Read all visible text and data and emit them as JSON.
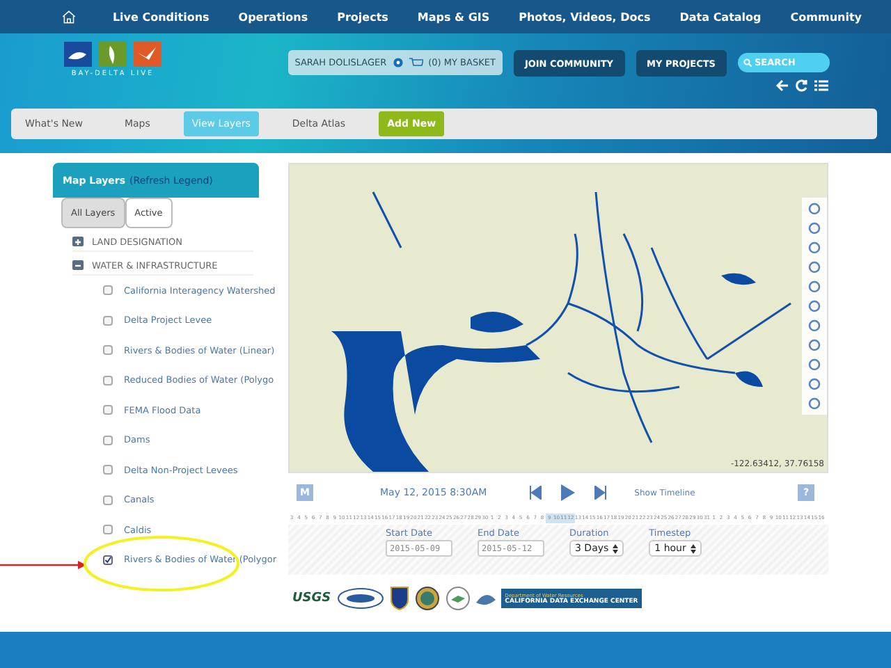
{
  "top_nav": {
    "items": [
      "Live Conditions",
      "Operations",
      "Projects",
      "Maps & GIS",
      "Photos, Videos, Docs",
      "Data Catalog",
      "Community"
    ]
  },
  "header": {
    "logo_text": "BAY-DELTA LIVE",
    "user": "SARAH DOLISLAGER",
    "basket": "(0) MY BASKET",
    "buttons": [
      "JOIN COMMUNITY",
      "MY PROJECTS"
    ],
    "search": {
      "placeholder": "SEARCH"
    }
  },
  "sub_nav": [
    {
      "label": "What's New",
      "kind": "link",
      "selected": false
    },
    {
      "label": "Maps",
      "kind": "link",
      "selected": false
    },
    {
      "label": "View Layers",
      "kind": "link",
      "selected": true
    },
    {
      "label": "Delta Atlas",
      "kind": "link",
      "selected": false
    },
    {
      "label": "Add New",
      "kind": "action",
      "selected": false
    }
  ],
  "layers_panel": {
    "title": "Map Layers",
    "refresh": "(Refresh Legend)",
    "tabs": [
      {
        "label": "All Layers",
        "selected": true
      },
      {
        "label": "Active",
        "selected": false
      }
    ],
    "groups": [
      {
        "name": "LAND DESIGNATION",
        "expanded": false
      },
      {
        "name": "WATER & INFRASTRUCTURE",
        "expanded": true,
        "children": [
          {
            "name": "California Interagency Watershed",
            "checked": false
          },
          {
            "name": "Delta Project Levee",
            "checked": false
          },
          {
            "name": "Rivers & Bodies of Water (Linear)",
            "checked": false
          },
          {
            "name": "Reduced Bodies of Water (Polygo",
            "checked": false
          },
          {
            "name": "FEMA Flood Data",
            "checked": false
          },
          {
            "name": "Dams",
            "checked": false
          },
          {
            "name": "Delta Non-Project Levees",
            "checked": false
          },
          {
            "name": "Canals",
            "checked": false
          },
          {
            "name": "Caldis",
            "checked": false
          },
          {
            "name": "Rivers & Bodies of Water (Polygor",
            "checked": true
          }
        ]
      }
    ]
  },
  "map": {
    "coordinates": "-122.63412, 37.76158"
  },
  "player": {
    "mode_button": "M",
    "datetime": "May 12, 2015 8:30AM",
    "timeline_link": "Show Timeline",
    "help": "?"
  },
  "timeline": {
    "days": [
      {
        "d": "3",
        "selected": false
      },
      {
        "d": "4",
        "selected": false
      },
      {
        "d": "5",
        "selected": false
      },
      {
        "d": "6",
        "selected": false
      },
      {
        "d": "7",
        "selected": false
      },
      {
        "d": "8",
        "selected": false
      },
      {
        "d": "9",
        "selected": false
      },
      {
        "d": "10",
        "selected": false
      },
      {
        "d": "11",
        "selected": false
      },
      {
        "d": "12",
        "selected": false
      },
      {
        "d": "13",
        "selected": false
      },
      {
        "d": "14",
        "selected": false
      },
      {
        "d": "15",
        "selected": false
      },
      {
        "d": "16",
        "selected": false
      },
      {
        "d": "17",
        "selected": false
      },
      {
        "d": "18",
        "selected": false
      },
      {
        "d": "19",
        "selected": false
      },
      {
        "d": "20",
        "selected": false
      },
      {
        "d": "21",
        "selected": false
      },
      {
        "d": "22",
        "selected": false
      },
      {
        "d": "23",
        "selected": false
      },
      {
        "d": "24",
        "selected": false
      },
      {
        "d": "25",
        "selected": false
      },
      {
        "d": "26",
        "selected": false
      },
      {
        "d": "27",
        "selected": false
      },
      {
        "d": "28",
        "selected": false
      },
      {
        "d": "29",
        "selected": false
      },
      {
        "d": "30",
        "selected": false
      },
      {
        "d": "1",
        "selected": false
      },
      {
        "d": "2",
        "selected": false
      },
      {
        "d": "3",
        "selected": false
      },
      {
        "d": "4",
        "selected": false
      },
      {
        "d": "5",
        "selected": false
      },
      {
        "d": "6",
        "selected": false
      },
      {
        "d": "7",
        "selected": false
      },
      {
        "d": "8",
        "selected": false
      },
      {
        "d": "9",
        "selected": true
      },
      {
        "d": "10",
        "selected": true
      },
      {
        "d": "11",
        "selected": true
      },
      {
        "d": "12",
        "selected": true
      },
      {
        "d": "13",
        "selected": false
      },
      {
        "d": "14",
        "selected": false
      },
      {
        "d": "15",
        "selected": false
      },
      {
        "d": "16",
        "selected": false
      },
      {
        "d": "17",
        "selected": false
      },
      {
        "d": "18",
        "selected": false
      },
      {
        "d": "19",
        "selected": false
      },
      {
        "d": "20",
        "selected": false
      },
      {
        "d": "21",
        "selected": false
      },
      {
        "d": "22",
        "selected": false
      },
      {
        "d": "23",
        "selected": false
      },
      {
        "d": "24",
        "selected": false
      },
      {
        "d": "25",
        "selected": false
      },
      {
        "d": "26",
        "selected": false
      },
      {
        "d": "27",
        "selected": false
      },
      {
        "d": "28",
        "selected": false
      },
      {
        "d": "29",
        "selected": false
      },
      {
        "d": "30",
        "selected": false
      },
      {
        "d": "31",
        "selected": false
      },
      {
        "d": "1",
        "selected": false
      },
      {
        "d": "2",
        "selected": false
      },
      {
        "d": "3",
        "selected": false
      },
      {
        "d": "4",
        "selected": false
      },
      {
        "d": "5",
        "selected": false
      },
      {
        "d": "6",
        "selected": false
      },
      {
        "d": "7",
        "selected": false
      },
      {
        "d": "8",
        "selected": false
      },
      {
        "d": "9",
        "selected": false
      },
      {
        "d": "10",
        "selected": false
      },
      {
        "d": "11",
        "selected": false
      },
      {
        "d": "12",
        "selected": false
      },
      {
        "d": "13",
        "selected": false
      },
      {
        "d": "14",
        "selected": false
      },
      {
        "d": "15",
        "selected": false
      },
      {
        "d": "16",
        "selected": false
      }
    ]
  },
  "date_form": {
    "start_label": "Start Date",
    "start_value": "2015-05-09",
    "end_label": "End Date",
    "end_value": "2015-05-12",
    "duration_label": "Duration",
    "duration_value": "3 Days",
    "timestep_label": "Timestep",
    "timestep_value": "1 hour"
  },
  "sponsors": {
    "usgs": "USGS",
    "dwr_top": "Department of Water Resources",
    "dwr_bottom": "CALIFORNIA DATA EXCHANGE CENTER"
  }
}
